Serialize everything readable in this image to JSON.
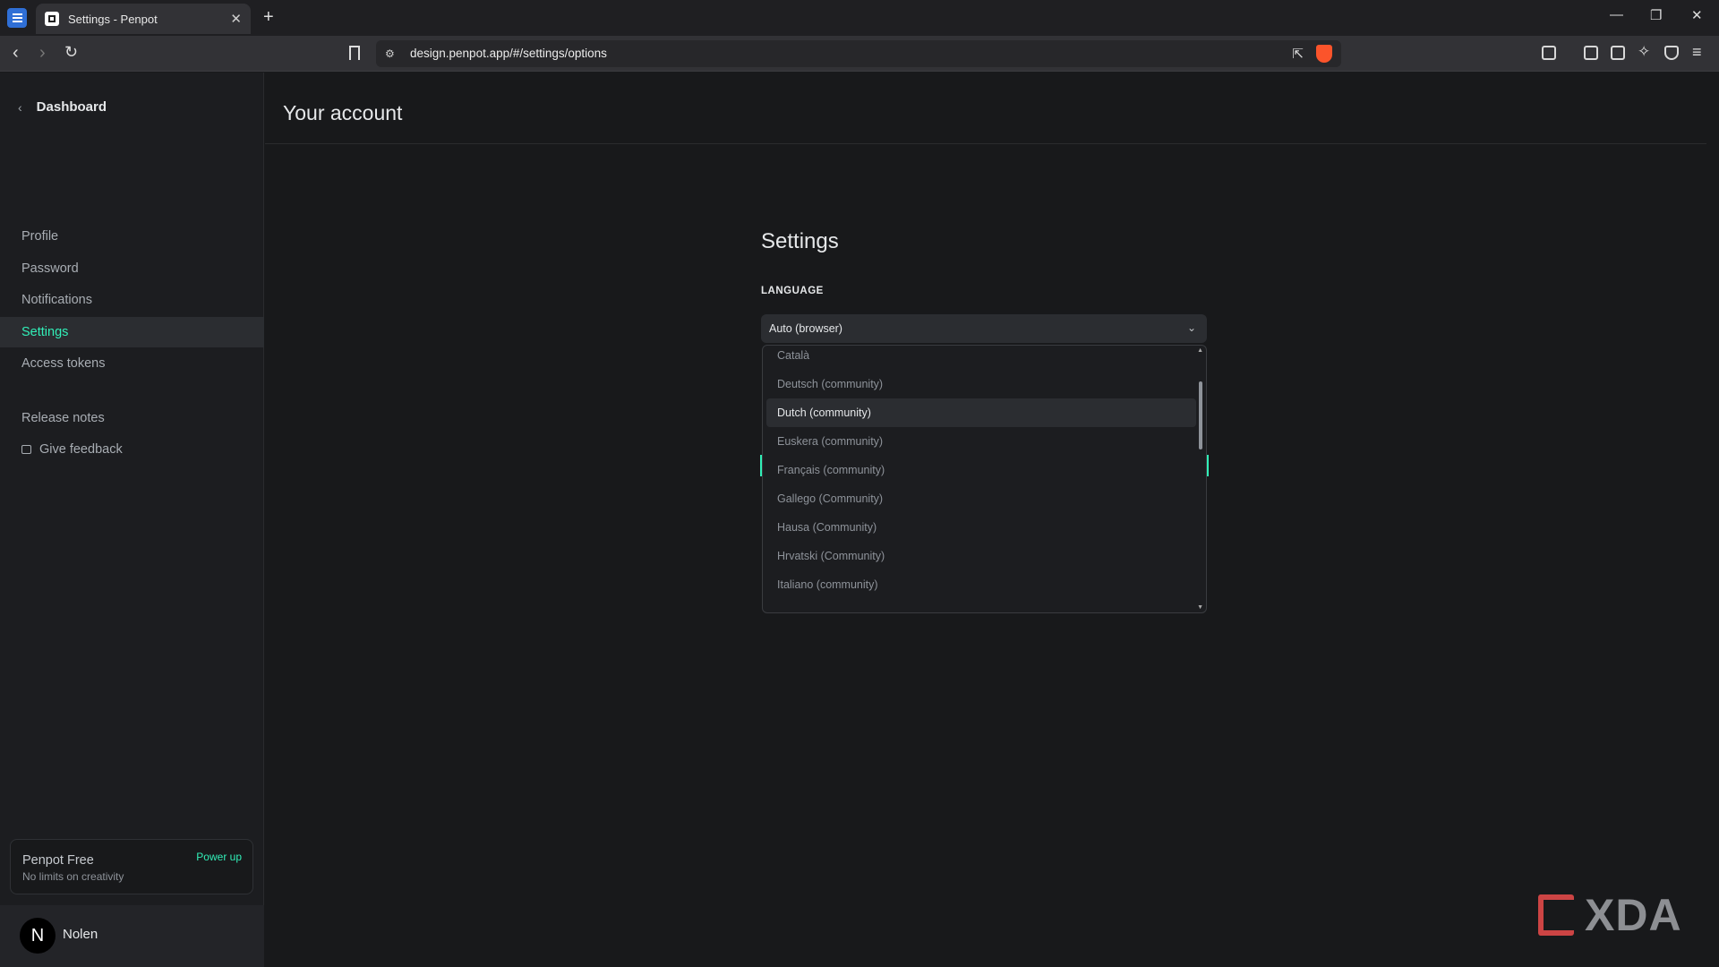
{
  "browser": {
    "tab_title": "Settings - Penpot",
    "url": "design.penpot.app/#/settings/options"
  },
  "sidebar": {
    "back_label": "Dashboard",
    "items": [
      {
        "label": "Profile"
      },
      {
        "label": "Password"
      },
      {
        "label": "Notifications"
      },
      {
        "label": "Settings"
      },
      {
        "label": "Access tokens"
      },
      {
        "label": "Release notes"
      },
      {
        "label": "Give feedback"
      }
    ],
    "active_item": "Settings",
    "plan": {
      "name": "Penpot Free",
      "subtitle": "No limits on creativity",
      "cta": "Power up"
    },
    "user": {
      "initial": "N",
      "name": "Nolen"
    }
  },
  "header": {
    "title": "Your account"
  },
  "settings": {
    "title": "Settings",
    "language_label": "LANGUAGE",
    "selected_language": "Auto (browser)",
    "options": [
      "Català",
      "Deutsch (community)",
      "Dutch (community)",
      "Euskera (community)",
      "Français (community)",
      "Gallego (Community)",
      "Hausa (Community)",
      "Hrvatski (Community)",
      "Italiano (community)"
    ],
    "highlighted_option": "Dutch (community)"
  },
  "watermark": {
    "text": "XDA"
  },
  "colors": {
    "accent": "#31efb8",
    "background": "#18191b",
    "sidebar": "#1c1d20"
  }
}
